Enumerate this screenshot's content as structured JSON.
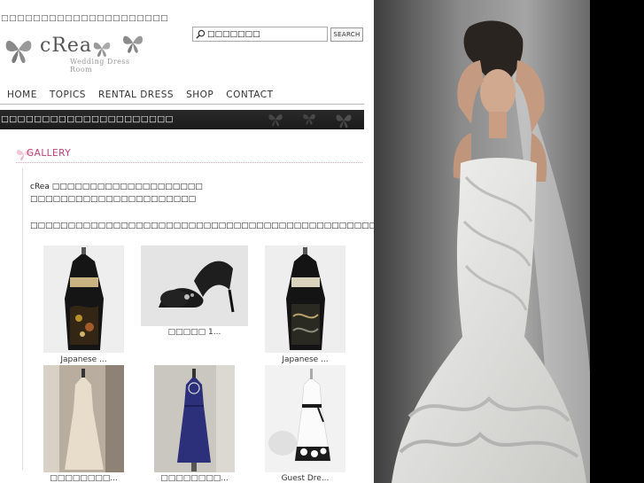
{
  "header": {
    "tagline": "□□□□□□□□□□□□□□□□□□□□□",
    "logo_text": "cRea",
    "logo_sub": "Wedding Dress Room"
  },
  "search": {
    "value": "□□□□□□□",
    "button_label": "SEARCH"
  },
  "nav": {
    "items": [
      "HOME",
      "TOPICS",
      "RENTAL DRESS",
      "SHOP",
      "CONTACT"
    ]
  },
  "banner": {
    "text": "□□□□□□□□□□□□□□□□□□□□□"
  },
  "gallery": {
    "title": "GALLERY",
    "intro_line1": "cRea □□□□□□□□□□□□□□□□□□□□",
    "intro_line2": "□□□□□□□□□□□□□□□□□□□□□□",
    "intro_line3": "□□□□□□□□□□□□□□□□□□□□□□□□□□□□□□□□□□□□□□□□□□□□□□□□□□□□□□□□□□□□□",
    "items": [
      {
        "caption": "Japanese ..."
      },
      {
        "caption": "□□□□□ 1..."
      },
      {
        "caption": "Japanese ..."
      },
      {
        "caption": "□□□□□□□□..."
      },
      {
        "caption": "□□□□□□□□..."
      },
      {
        "caption": "Guest Dre..."
      }
    ]
  },
  "colors": {
    "accent": "#c0406f",
    "banner_bg": "#222222",
    "nav_text": "#333333"
  }
}
